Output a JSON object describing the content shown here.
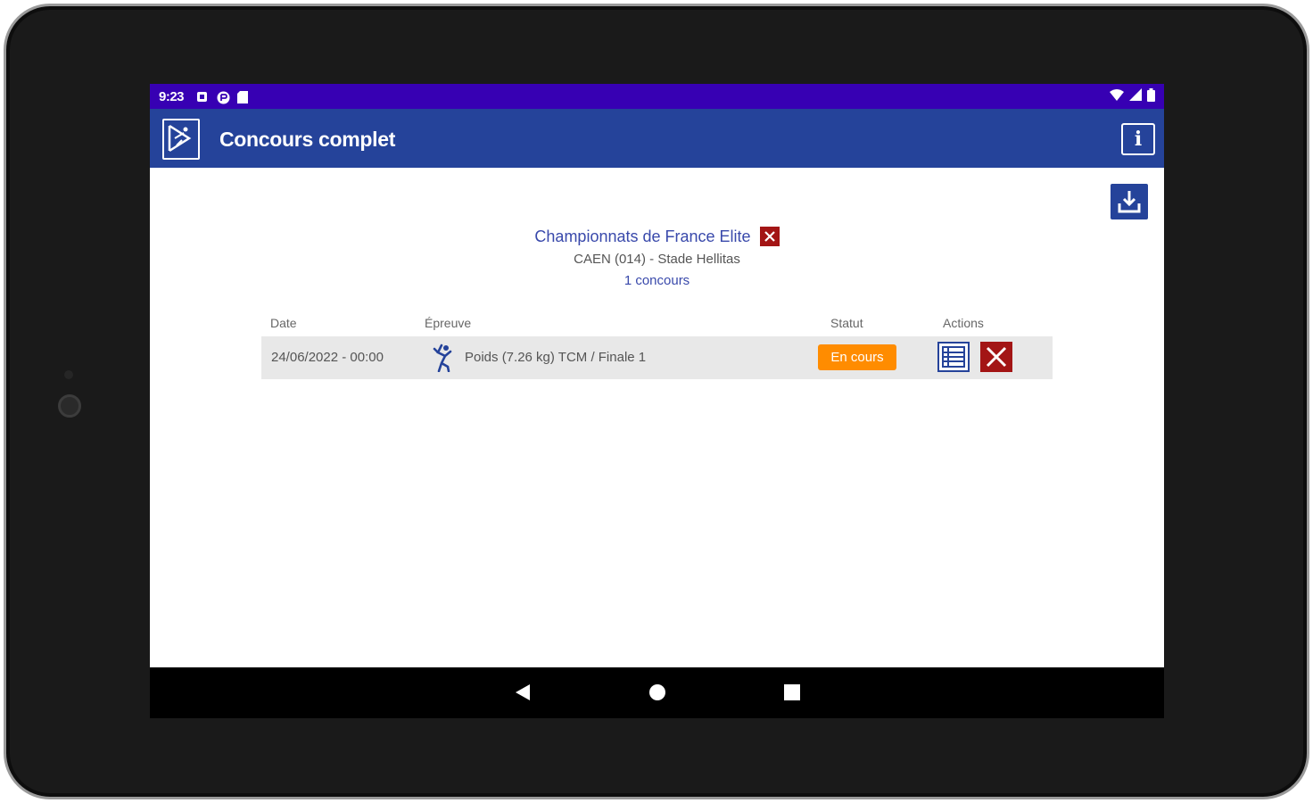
{
  "statusbar": {
    "time": "9:23",
    "left_icons": [
      "notification-icon",
      "media-icon",
      "sd-card-icon"
    ],
    "right_icons": [
      "wifi-icon",
      "signal-icon",
      "battery-icon"
    ]
  },
  "appbar": {
    "title": "Concours complet",
    "logo_icon": "app-logo-icon",
    "info_icon": "info-icon"
  },
  "event": {
    "title": "Championnats de France Elite",
    "location": "CAEN (014) - Stade Hellitas",
    "count": "1 concours"
  },
  "table": {
    "headers": {
      "date": "Date",
      "event": "Épreuve",
      "status": "Statut",
      "actions": "Actions"
    },
    "rows": [
      {
        "date": "24/06/2022 - 00:00",
        "event": "Poids (7.26 kg) TCM / Finale 1",
        "status": "En cours"
      }
    ]
  },
  "colors": {
    "statusbar": "#3700b3",
    "appbar": "#25439a",
    "accent_text": "#3949ab",
    "status_badge": "#ff8c00",
    "delete": "#a31515",
    "row_bg": "#e8e8e8"
  }
}
